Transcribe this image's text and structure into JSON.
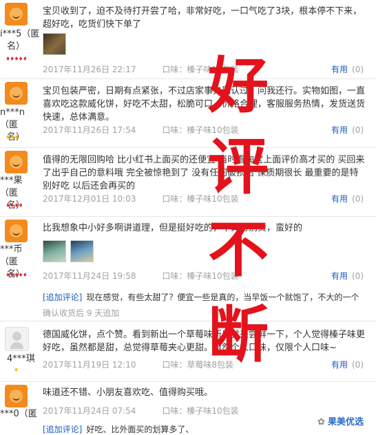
{
  "useful_label": "有用",
  "useful_count": "(0)",
  "append_label": "[追加评论]",
  "reviews": [
    {
      "user_line1": "i***5（匿",
      "user_line2": "名）",
      "text": "宝贝收到了，迫不及待打开尝了哈，非常好吃，一口气吃了3块，根本停不下来，超好吃，吃货们快下单了",
      "date": "2017年11月26日 22:17",
      "flavor": "口味：榛子味10包装"
    },
    {
      "user_line1": "n***n（匿",
      "user_line2": "名）",
      "text": "宝贝包装严密，日期有点紧张，不过店家事先确认过，问我还行。实物如图，一直喜欢吃这款威化饼，好吃不太甜，松脆可口，价格合理，客服服务热情，发货送货快速，总体满意。",
      "date": "2017年11月26日 17:54",
      "flavor": "口味：榛子味10包装"
    },
    {
      "user_line1": "***果（匿",
      "user_line2": "名）",
      "text": "值得的无限回购哈 比小红书上面买的还便宜 当时看淘宝上面评价高才买的 买回来了出乎自己的意料哦 完全被惊艳到了 没有任何破损哈 保质期很长 最重要的是特别好吃 以后还会再买的",
      "date": "2017年12月01日 10:03",
      "flavor": "口味：榛子味10包装"
    },
    {
      "user_line1": "***币（匿",
      "user_line2": "名）",
      "text": "比我想象中小好多啊讲道理，但是挺好吃的，不算特别贵，蛮好的",
      "date": "2017年11月24日 19:58",
      "flavor": "口味：榛子味10包装",
      "append_text": "现在感觉，有些太甜了？便宜一些是真的，当早饭一个就饱了，不大的一个",
      "append_note": "确认收货后 9 天追加"
    },
    {
      "user_line1": "4***琪",
      "text": "德国威化饼，点个赞。看到新出一个草莓味所以就来尝鲜一下，个人觉得榛子味更好吃，虽然都是甜，总觉得草莓夹心更甜。当然个人口味，仅限个人口味~",
      "date": "2017年11月19日 12:10",
      "flavor": "口味：草莓味8包装"
    },
    {
      "user_line1": "***0（匿",
      "text": "味道还不错、小朋友喜欢吃、值得购买哦。",
      "date": "2017年11月24日 07:54",
      "flavor": "口味：榛子味10包装",
      "append_text": "好吃、比外面买的划算多了、"
    }
  ],
  "overlay": [
    "好",
    "评",
    "不",
    "断"
  ],
  "watermark": "果美优选",
  "colors": {
    "overlay_red": "#e3121b",
    "link_blue": "#1b5bb8",
    "medal_red": "#e0303a",
    "medal_gold": "#f2b705"
  }
}
